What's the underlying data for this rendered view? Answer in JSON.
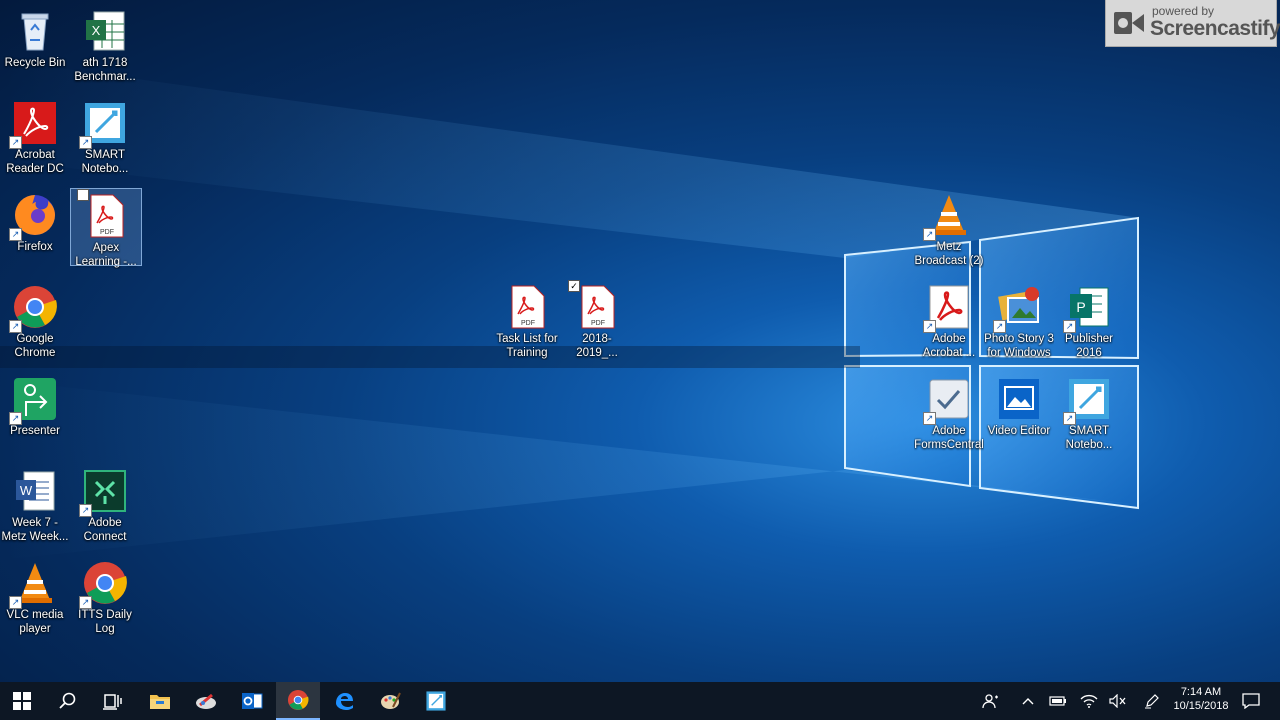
{
  "desktop_icons": [
    {
      "label": "Recycle Bin"
    },
    {
      "label": "ath 1718 Benchmar..."
    },
    {
      "label": "Acrobat Reader DC"
    },
    {
      "label": "SMART Notebo..."
    },
    {
      "label": "Firefox"
    },
    {
      "label": "Apex Learning -..."
    },
    {
      "label": "Google Chrome"
    },
    {
      "label": "Presenter"
    },
    {
      "label": "Week 7 - Metz Week..."
    },
    {
      "label": "Adobe Connect"
    },
    {
      "label": "VLC media player"
    },
    {
      "label": "ITTS Daily Log"
    },
    {
      "label": "Task List for Training"
    },
    {
      "label": "2018-2019_..."
    },
    {
      "label": "Metz Broadcast (2)"
    },
    {
      "label": "Adobe Acrobat ..."
    },
    {
      "label": "Photo Story 3 for Windows"
    },
    {
      "label": "Publisher 2016"
    },
    {
      "label": "Adobe FormsCentral"
    },
    {
      "label": "Video Editor"
    },
    {
      "label": "SMART Notebo..."
    }
  ],
  "pdf_badge": "PDF",
  "watermark": {
    "line1": "powered by",
    "line2": "Screencastify"
  },
  "clock": {
    "time": "7:14 AM",
    "date": "10/15/2018"
  },
  "colors": {
    "taskbar": "#0d1724",
    "desktop": "#0f5cae",
    "accent": "#7cb6ff"
  }
}
